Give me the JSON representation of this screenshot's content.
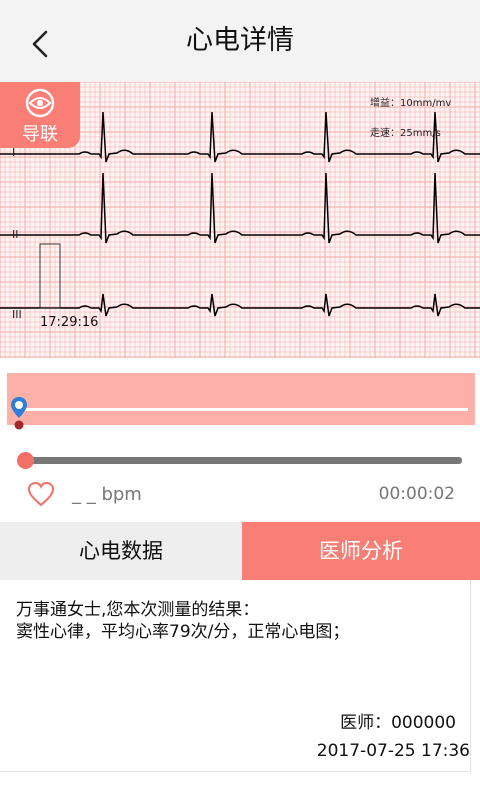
{
  "header": {
    "title": "心电详情",
    "back_icon": "chevron-left-icon"
  },
  "ecg": {
    "lead_button_label": "导联",
    "lead_button_icon": "eye-icon",
    "gain_label": "增益：10mm/mv",
    "speed_label": "走速：25mm/s",
    "leads": [
      "I",
      "II",
      "III"
    ],
    "marker_time": "17:29:16",
    "grid_color": "#f4a8a8",
    "trace_color": "#000000"
  },
  "playback": {
    "heart_icon": "heart-icon",
    "bpm_label": "_ _ bpm",
    "elapsed": "00:00:02",
    "progress": 0.0,
    "accent": "#f87e76",
    "timeline_color": "#fdb0a8"
  },
  "tabs": [
    {
      "label": "心电数据",
      "active": false
    },
    {
      "label": "医师分析",
      "active": true
    }
  ],
  "analysis": {
    "greeting": "万事通女士,您本次测量的结果：",
    "result": "窦性心律，平均心率79次/分，正常心电图；",
    "doctor_label": "医师：000000",
    "datetime": "2017-07-25 17:36"
  }
}
